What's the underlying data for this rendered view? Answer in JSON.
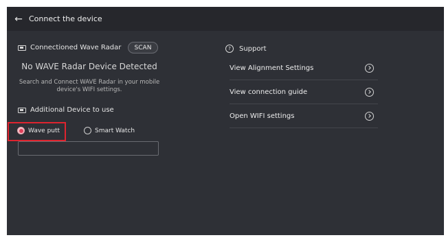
{
  "header": {
    "back_icon": "arrow-left-icon",
    "title": "Connect the device"
  },
  "radar_section": {
    "icon": "device-icon",
    "title": "Connectioned Wave Radar",
    "scan_label": "SCAN",
    "status": "No WAVE Radar Device Detected",
    "hint_line1": "Search and Connect WAVE Radar in your mobile",
    "hint_line2": "device's WIFI settings."
  },
  "additional_section": {
    "icon": "device-icon",
    "title": "Additional Device to use",
    "options": [
      {
        "label": "Wave putt",
        "selected": true
      },
      {
        "label": "Smart Watch",
        "selected": false
      }
    ],
    "input_value": "",
    "input_placeholder": ""
  },
  "support": {
    "icon": "help-circle-icon",
    "title": "Support",
    "items": [
      {
        "label": "View Alignment Settings",
        "icon": "chevron-right-circle-icon"
      },
      {
        "label": "View connection guide",
        "icon": "chevron-right-circle-icon"
      },
      {
        "label": "Open WIFI settings",
        "icon": "chevron-right-circle-icon"
      }
    ]
  },
  "colors": {
    "background": "#2e3036",
    "topbar": "#26272c",
    "radio_selected": "#e0405a",
    "highlight": "#e0242f"
  }
}
